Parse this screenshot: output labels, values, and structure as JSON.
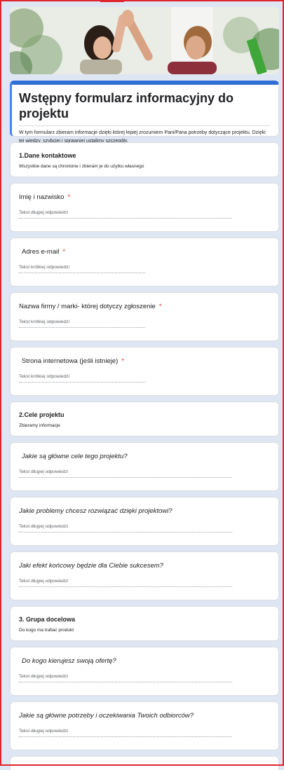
{
  "form": {
    "title": "Wstępny formularz informacyjny do projektu",
    "description": "W tym formularz zbieram informacje dzięki której lepiej zrozumiem Pani/Pana potrzeby dotyczące projektu. Dzięki tej wiedzy, szybciej i sprawniej ustalimy szczegóły.",
    "accent_color": "#4285f4",
    "required_mark": "*"
  },
  "sections": {
    "s1": {
      "title": "1.Dane kontaktowe",
      "description": "Wszystkie dane są chronione i zbieram je do użytku własnego"
    },
    "s2": {
      "title": "2.Cele projektu",
      "description": "Zbieramy informacje"
    },
    "s3": {
      "title": "3. Grupa docelowa",
      "description": "Do kogo ma trafiać produkt"
    }
  },
  "questions": {
    "q1": {
      "label": "Imię i nazwisko",
      "answer_placeholder": "Tekst długiej odpowiedzi",
      "required": true
    },
    "q2": {
      "label": "Adres e-mail",
      "answer_placeholder": "Tekst krótkiej odpowiedzi",
      "required": true
    },
    "q3": {
      "label": "Nazwa firmy / marki- której dotyczy zgłoszenie",
      "answer_placeholder": "Tekst krótkiej odpowiedzi",
      "required": true
    },
    "q4": {
      "label": "Strona internetowa (jeśli istnieje)",
      "answer_placeholder": "Tekst krótkiej odpowiedzi",
      "required": true
    },
    "q5": {
      "label": "Jakie są główne cele tego projektu?",
      "answer_placeholder": "Tekst długiej odpowiedzi",
      "required": false
    },
    "q6": {
      "label": "Jakie problemy chcesz rozwiązać dzięki projektowi?",
      "answer_placeholder": "Tekst długiej odpowiedzi",
      "required": false
    },
    "q7": {
      "label": "Jaki efekt końcowy będzie dla Ciebie sukcesem?",
      "answer_placeholder": "Tekst długiej odpowiedzi",
      "required": false
    },
    "q8": {
      "label": "Do kogo kierujesz swoją ofertę?",
      "answer_placeholder": "Tekst długiej odpowiedzi",
      "required": false
    },
    "q9": {
      "label": "Jakie są główne potrzeby i oczekiwania Twoich odbiorców?",
      "answer_placeholder": "Tekst długiej odpowiedzi",
      "required": false
    }
  }
}
